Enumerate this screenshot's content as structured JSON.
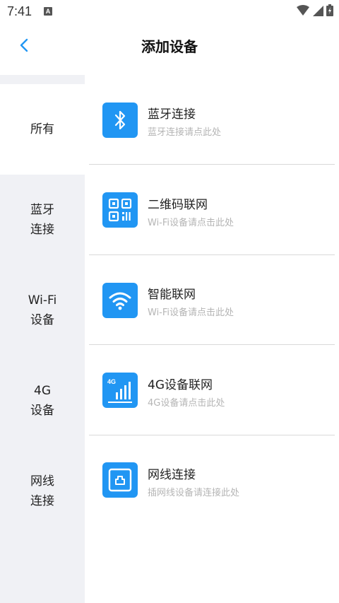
{
  "status_bar": {
    "time": "7:41",
    "notif_glyph": "A"
  },
  "header": {
    "title": "添加设备",
    "back_icon": "chevron-left-icon"
  },
  "sidebar": {
    "items": [
      {
        "label": "所有",
        "active": true
      },
      {
        "label": "蓝牙\n连接",
        "active": false
      },
      {
        "label": "Wi-Fi\n设备",
        "active": false
      },
      {
        "label": "4G\n设备",
        "active": false
      },
      {
        "label": "网线\n连接",
        "active": false
      }
    ]
  },
  "options": [
    {
      "icon": "bluetooth-icon",
      "title": "蓝牙连接",
      "subtitle": "蓝牙连接请点此处"
    },
    {
      "icon": "qr-code-icon",
      "title": "二维码联网",
      "subtitle": "Wi-Fi设备请点击此处"
    },
    {
      "icon": "wifi-icon",
      "title": "智能联网",
      "subtitle": "Wi-Fi设备请点击此处"
    },
    {
      "icon": "4g-signal-icon",
      "icon_text": "4G",
      "title": "4G设备联网",
      "subtitle": "4G设备请点击此处"
    },
    {
      "icon": "ethernet-port-icon",
      "title": "网线连接",
      "subtitle": "插网线设备请连接此处"
    }
  ],
  "colors": {
    "accent": "#2196f3",
    "sidebar_bg": "#f0f1f5",
    "subtitle": "#b5b5b5"
  }
}
